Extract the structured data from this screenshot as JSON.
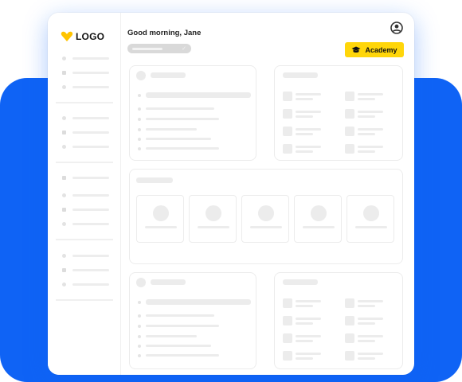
{
  "header": {
    "greeting": "Good morning, Jane",
    "academy_label": "Academy"
  },
  "logo": {
    "text": "LOGO"
  },
  "icons": {
    "logo_mark": "heart-logo-icon",
    "profile": "user-circle-icon",
    "academy": "graduation-cap-icon",
    "search_check": "check-icon"
  },
  "colors": {
    "brand_blue": "#0f63f5",
    "accent_yellow": "#ffd60a",
    "placeholder_gray": "#ececec"
  }
}
